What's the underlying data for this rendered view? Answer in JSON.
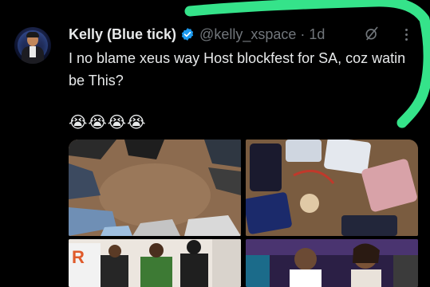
{
  "tweet": {
    "author_name": "Kelly (Blue tick)",
    "handle_time": "@kelly_xspace · 1d",
    "text": "I no blame xeus way Host blockfest for SA, coz watin be This?",
    "emojis": "😭😭😭😭"
  },
  "icons": {
    "verified": "verified-badge-icon",
    "grok": "grok-icon",
    "more": "more-options-icon"
  },
  "colors": {
    "background": "#000000",
    "text": "#e7e9ea",
    "secondary": "#71767b",
    "verified_blue": "#1d9bf0",
    "highlighter_green": "#35e38a"
  },
  "media": [
    {
      "description_icon": "photo-shoes-circle"
    },
    {
      "description_icon": "photo-phones-circle"
    },
    {
      "description_icon": "photo-event-people"
    },
    {
      "description_icon": "photo-selfie-people"
    }
  ]
}
